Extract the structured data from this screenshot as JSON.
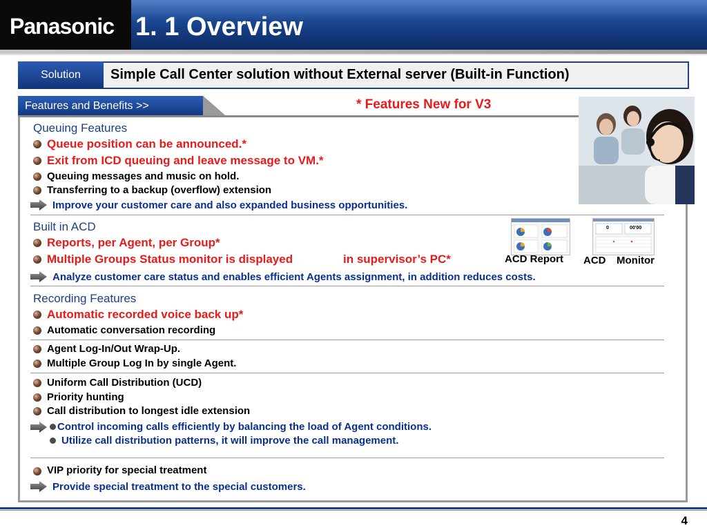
{
  "header": {
    "logo_text": "Panasonic",
    "title": "1. 1 Overview"
  },
  "solution": {
    "label": "Solution",
    "text": "Simple Call Center solution without External server (Built-in Function)"
  },
  "tab": {
    "label": "Features and Benefits >>",
    "v3_note": "* Features New for V3"
  },
  "queuing": {
    "heading": "Queuing Features",
    "items": [
      "Queue position can be announced.*",
      "Exit from ICD queuing and leave message to VM.*",
      "Queuing messages and music on hold.",
      "Transferring to a backup (overflow) extension"
    ],
    "benefit": "Improve  your customer care and also expanded business opportunities."
  },
  "acd": {
    "heading": "Built in ACD",
    "items": [
      "Reports, per Agent, per Group*",
      "Multiple Groups Status monitor is displayed",
      "in supervisor’s PC*"
    ],
    "benefit": "Analyze customer care status and enables efficient Agents assignment, in addition reduces costs.",
    "report_label": "ACD Report",
    "monitor_label_1": "ACD",
    "monitor_label_2": "Monitor",
    "monitor_values": [
      "0",
      "00'00"
    ]
  },
  "recording": {
    "heading": "Recording Features",
    "items": [
      "Automatic recorded voice back up*",
      "Automatic conversation recording"
    ]
  },
  "login": {
    "items": [
      "Agent Log-In/Out Wrap-Up.",
      "Multiple Group Log In by single Agent."
    ]
  },
  "distribution": {
    "items": [
      "Uniform Call Distribution (UCD)",
      "Priority hunting",
      "Call distribution to longest idle extension"
    ],
    "benefits": [
      "Control incoming calls efficiently by balancing  the load of Agent conditions.",
      "Utilize call distribution patterns, it  will improve the call management."
    ]
  },
  "vip": {
    "items": [
      "VIP priority for special treatment"
    ],
    "benefit": "Provide special treatment to the special customers."
  },
  "page_number": "4",
  "colors": {
    "brand_blue": "#1f3f80",
    "accent_red": "#e81a1a",
    "benefit_blue": "#0a2f90"
  }
}
